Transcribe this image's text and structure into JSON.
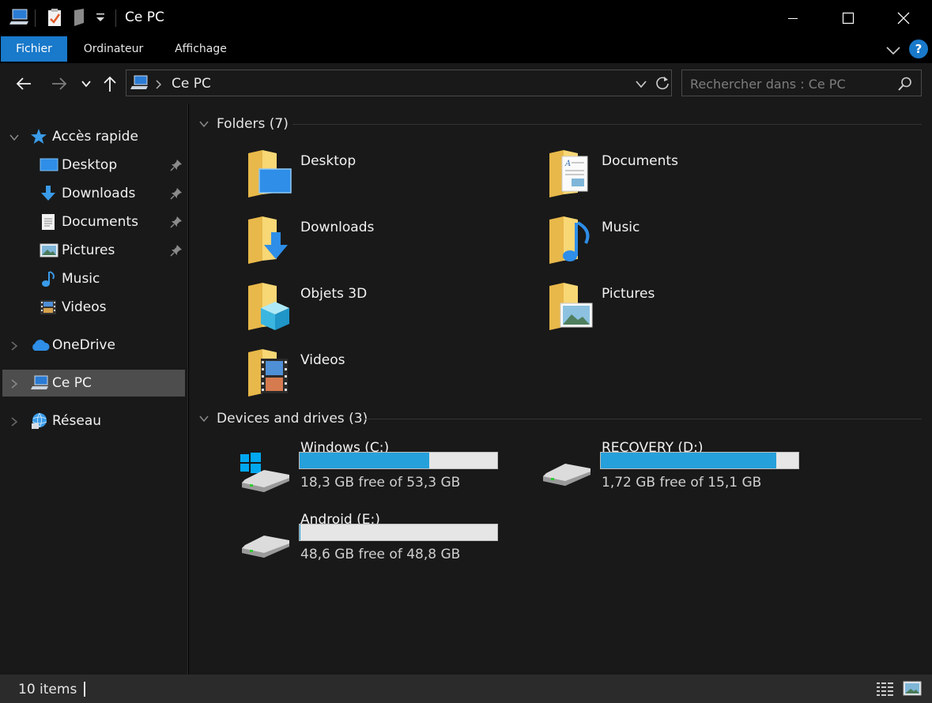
{
  "window": {
    "title": "Ce PC",
    "controls": [
      "minimize-icon",
      "maximize-icon",
      "close-icon"
    ]
  },
  "ribbon": {
    "tabs": [
      {
        "label": "Fichier",
        "active": true
      },
      {
        "label": "Ordinateur",
        "active": false
      },
      {
        "label": "Affichage",
        "active": false
      }
    ],
    "help_label": "?"
  },
  "navigation": {
    "address": "Ce PC",
    "search_placeholder": "Rechercher dans : Ce PC"
  },
  "sidebar": {
    "quick_access": "Accès rapide",
    "pinned": [
      {
        "label": "Desktop",
        "icon": "desktop-icon"
      },
      {
        "label": "Downloads",
        "icon": "download-icon"
      },
      {
        "label": "Documents",
        "icon": "document-icon"
      },
      {
        "label": "Pictures",
        "icon": "pictures-icon"
      }
    ],
    "unpinned": [
      {
        "label": "Music",
        "icon": "music-icon"
      },
      {
        "label": "Videos",
        "icon": "video-icon"
      }
    ],
    "onedrive": "OneDrive",
    "this_pc": "Ce PC",
    "network": "Réseau"
  },
  "folders": {
    "header": "Folders (7)",
    "items": [
      {
        "label": "Desktop",
        "icon": "desktop-folder-icon"
      },
      {
        "label": "Documents",
        "icon": "documents-folder-icon"
      },
      {
        "label": "Downloads",
        "icon": "downloads-folder-icon"
      },
      {
        "label": "Music",
        "icon": "music-folder-icon"
      },
      {
        "label": "Objets 3D",
        "icon": "3d-objects-folder-icon"
      },
      {
        "label": "Pictures",
        "icon": "pictures-folder-icon"
      },
      {
        "label": "Videos",
        "icon": "videos-folder-icon"
      }
    ]
  },
  "drives": {
    "header": "Devices and drives (3)",
    "items": [
      {
        "label": "Windows (C:)",
        "free": "18,3 GB free of 53,3 GB",
        "used_fraction": 0.657,
        "icon": "windows-drive-icon"
      },
      {
        "label": "RECOVERY (D:)",
        "free": "1,72 GB free of 15,1 GB",
        "used_fraction": 0.886,
        "icon": "drive-icon"
      },
      {
        "label": "Android (E:)",
        "free": "48,6 GB free of 48,8 GB",
        "used_fraction": 0.004,
        "icon": "drive-icon"
      }
    ]
  },
  "status": {
    "count": "10 items"
  },
  "colors": {
    "accent": "#1979ca",
    "bar_fill": "#26a0da",
    "folder": "#f8d775"
  }
}
